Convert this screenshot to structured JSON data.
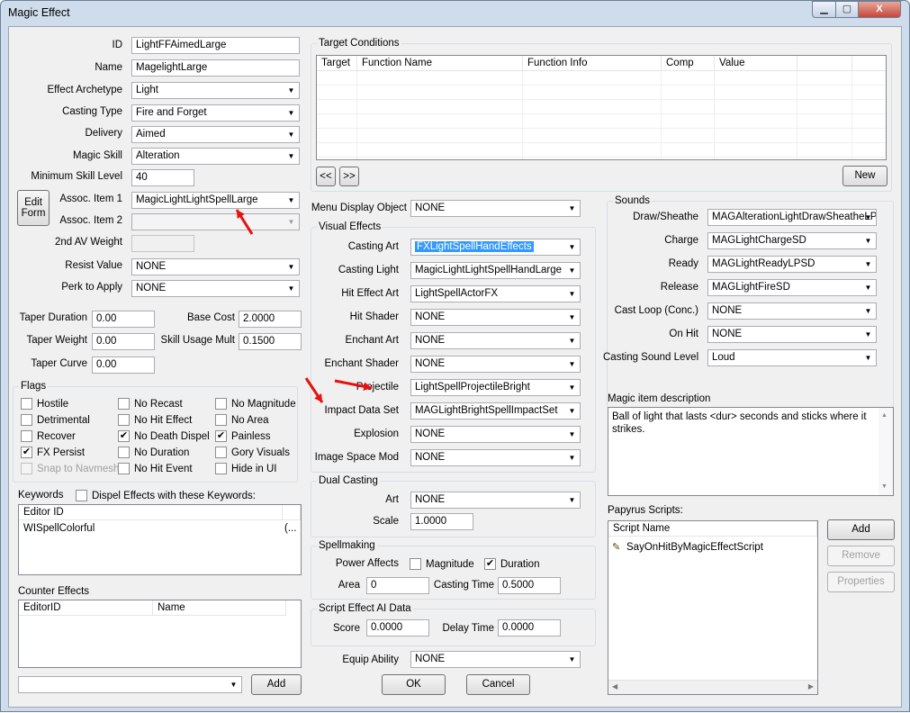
{
  "window": {
    "title": "Magic Effect",
    "min": "▁",
    "max": "▢",
    "close": "X"
  },
  "left": {
    "id_label": "ID",
    "id": "LightFFAimedLarge",
    "name_label": "Name",
    "name": "MagelightLarge",
    "archetype_label": "Effect Archetype",
    "archetype": "Light",
    "casting_type_label": "Casting Type",
    "casting_type": "Fire and Forget",
    "delivery_label": "Delivery",
    "delivery": "Aimed",
    "magic_skill_label": "Magic Skill",
    "magic_skill": "Alteration",
    "min_skill_label": "Minimum Skill Level",
    "min_skill": "40",
    "edit_form": "Edit Form",
    "assoc1_label": "Assoc. Item 1",
    "assoc1": "MagicLightLightSpellLarge",
    "assoc2_label": "Assoc. Item 2",
    "assoc2": "",
    "av2_label": "2nd AV Weight",
    "av2": "",
    "resist_label": "Resist Value",
    "resist": "NONE",
    "perk_label": "Perk to Apply",
    "perk": "NONE",
    "taper_duration_label": "Taper Duration",
    "taper_duration": "0.00",
    "taper_weight_label": "Taper Weight",
    "taper_weight": "0.00",
    "taper_curve_label": "Taper Curve",
    "taper_curve": "0.00",
    "base_cost_label": "Base Cost",
    "base_cost": "2.0000",
    "skill_mult_label": "Skill Usage Mult",
    "skill_mult": "0.1500"
  },
  "flags": {
    "title": "Flags",
    "items": [
      {
        "label": "Hostile",
        "checked": false,
        "disabled": false
      },
      {
        "label": "No Recast",
        "checked": false,
        "disabled": false
      },
      {
        "label": "No Magnitude",
        "checked": false,
        "disabled": false
      },
      {
        "label": "Detrimental",
        "checked": false,
        "disabled": false
      },
      {
        "label": "No Hit Effect",
        "checked": false,
        "disabled": false
      },
      {
        "label": "No Area",
        "checked": false,
        "disabled": false
      },
      {
        "label": "Recover",
        "checked": false,
        "disabled": false
      },
      {
        "label": "No Death Dispel",
        "checked": true,
        "disabled": false
      },
      {
        "label": "Painless",
        "checked": true,
        "disabled": false
      },
      {
        "label": "FX Persist",
        "checked": true,
        "disabled": false
      },
      {
        "label": "No Duration",
        "checked": false,
        "disabled": false
      },
      {
        "label": "Gory Visuals",
        "checked": false,
        "disabled": false
      },
      {
        "label": "Snap to Navmesh",
        "checked": false,
        "disabled": true
      },
      {
        "label": "No Hit Event",
        "checked": false,
        "disabled": false
      },
      {
        "label": "Hide in UI",
        "checked": false,
        "disabled": false
      }
    ]
  },
  "keywords": {
    "title": "Keywords",
    "dispel_label": "Dispel Effects with these Keywords:",
    "col1": "Editor ID",
    "col2": "",
    "rows": [
      {
        "id": "WISpellColorful",
        "extra": "(..."
      }
    ]
  },
  "counter": {
    "title": "Counter Effects",
    "col1": "EditorID",
    "col2": "Name",
    "combo": "",
    "add": "Add"
  },
  "target": {
    "title": "Target Conditions",
    "cols": [
      "Target",
      "Function Name",
      "Function Info",
      "Comp",
      "Value",
      ""
    ],
    "prev": "<<",
    "next": ">>",
    "new": "New"
  },
  "visual": {
    "menu_label": "Menu Display Object",
    "menu": "NONE",
    "title": "Visual Effects",
    "casting_art_label": "Casting Art",
    "casting_art": "FXLightSpellHandEffects",
    "casting_light_label": "Casting Light",
    "casting_light": "MagicLightLightSpellHandLarge",
    "hit_art_label": "Hit Effect Art",
    "hit_art": "LightSpellActorFX",
    "hit_shader_label": "Hit Shader",
    "hit_shader": "NONE",
    "enchant_art_label": "Enchant Art",
    "enchant_art": "NONE",
    "enchant_shader_label": "Enchant Shader",
    "enchant_shader": "NONE",
    "projectile_label": "Projectile",
    "projectile": "LightSpellProjectileBright",
    "impact_label": "Impact Data Set",
    "impact": "MAGLightBrightSpellImpactSet",
    "explosion_label": "Explosion",
    "explosion": "NONE",
    "ism_label": "Image Space Mod",
    "ism": "NONE"
  },
  "dual": {
    "title": "Dual Casting",
    "art_label": "Art",
    "art": "NONE",
    "scale_label": "Scale",
    "scale": "1.0000"
  },
  "spellmaking": {
    "title": "Spellmaking",
    "power_label": "Power Affects",
    "magnitude": "Magnitude",
    "duration": "Duration",
    "area_label": "Area",
    "area": "0",
    "casting_time_label": "Casting Time",
    "casting_time": "0.5000"
  },
  "script_ai": {
    "title": "Script Effect AI Data",
    "score_label": "Score",
    "score": "0.0000",
    "delay_label": "Delay Time",
    "delay": "0.0000"
  },
  "equip": {
    "label": "Equip Ability",
    "value": "NONE"
  },
  "buttons": {
    "ok": "OK",
    "cancel": "Cancel"
  },
  "sounds": {
    "title": "Sounds",
    "draw_label": "Draw/Sheathe",
    "draw": "MAGAlterationLightDrawSheatheLP",
    "charge_label": "Charge",
    "charge": "MAGLightChargeSD",
    "ready_label": "Ready",
    "ready": "MAGLightReadyLPSD",
    "release_label": "Release",
    "release": "MAGLightFireSD",
    "loop_label": "Cast Loop (Conc.)",
    "loop": "NONE",
    "onhit_label": "On Hit",
    "onhit": "NONE",
    "level_label": "Casting Sound Level",
    "level": "Loud"
  },
  "description": {
    "label": "Magic item description",
    "text": "Ball of light that lasts <dur> seconds and sticks where it strikes."
  },
  "papyrus": {
    "label": "Papyrus Scripts:",
    "col": "Script Name",
    "scripts": [
      "SayOnHitByMagicEffectScript"
    ],
    "add": "Add",
    "remove": "Remove",
    "properties": "Properties"
  },
  "annotations": {
    "color": "#e81010"
  }
}
